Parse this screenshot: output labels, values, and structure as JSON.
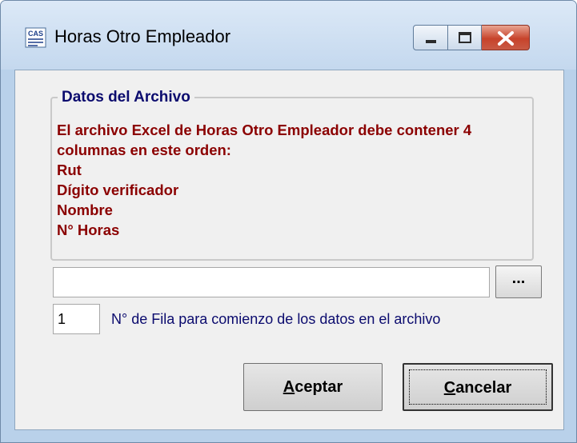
{
  "window": {
    "title": "Horas Otro Empleador",
    "icon": "cas-app-icon",
    "controls": [
      "minimize-icon",
      "maximize-icon",
      "close-icon"
    ]
  },
  "groupbox": {
    "title": "Datos del Archivo",
    "lines": [
      "El archivo Excel de Horas Otro Empleador debe contener 4",
      "columnas en este orden:",
      "Rut",
      "Dígito verificador",
      "Nombre",
      "N° Horas"
    ]
  },
  "file": {
    "value": "",
    "browse_label": "..."
  },
  "start_row": {
    "value": "1",
    "label": "N° de Fila para comienzo de los datos en el archivo"
  },
  "buttons": {
    "accept": {
      "mnemonic": "A",
      "rest": "ceptar"
    },
    "cancel": {
      "mnemonic": "C",
      "rest": "ancelar"
    }
  },
  "colors": {
    "frame": "#b9d1ea",
    "client": "#f0f0f0",
    "info_text": "#8b0000",
    "label_text": "#0b0b6e",
    "close_button": "#c7432b"
  }
}
